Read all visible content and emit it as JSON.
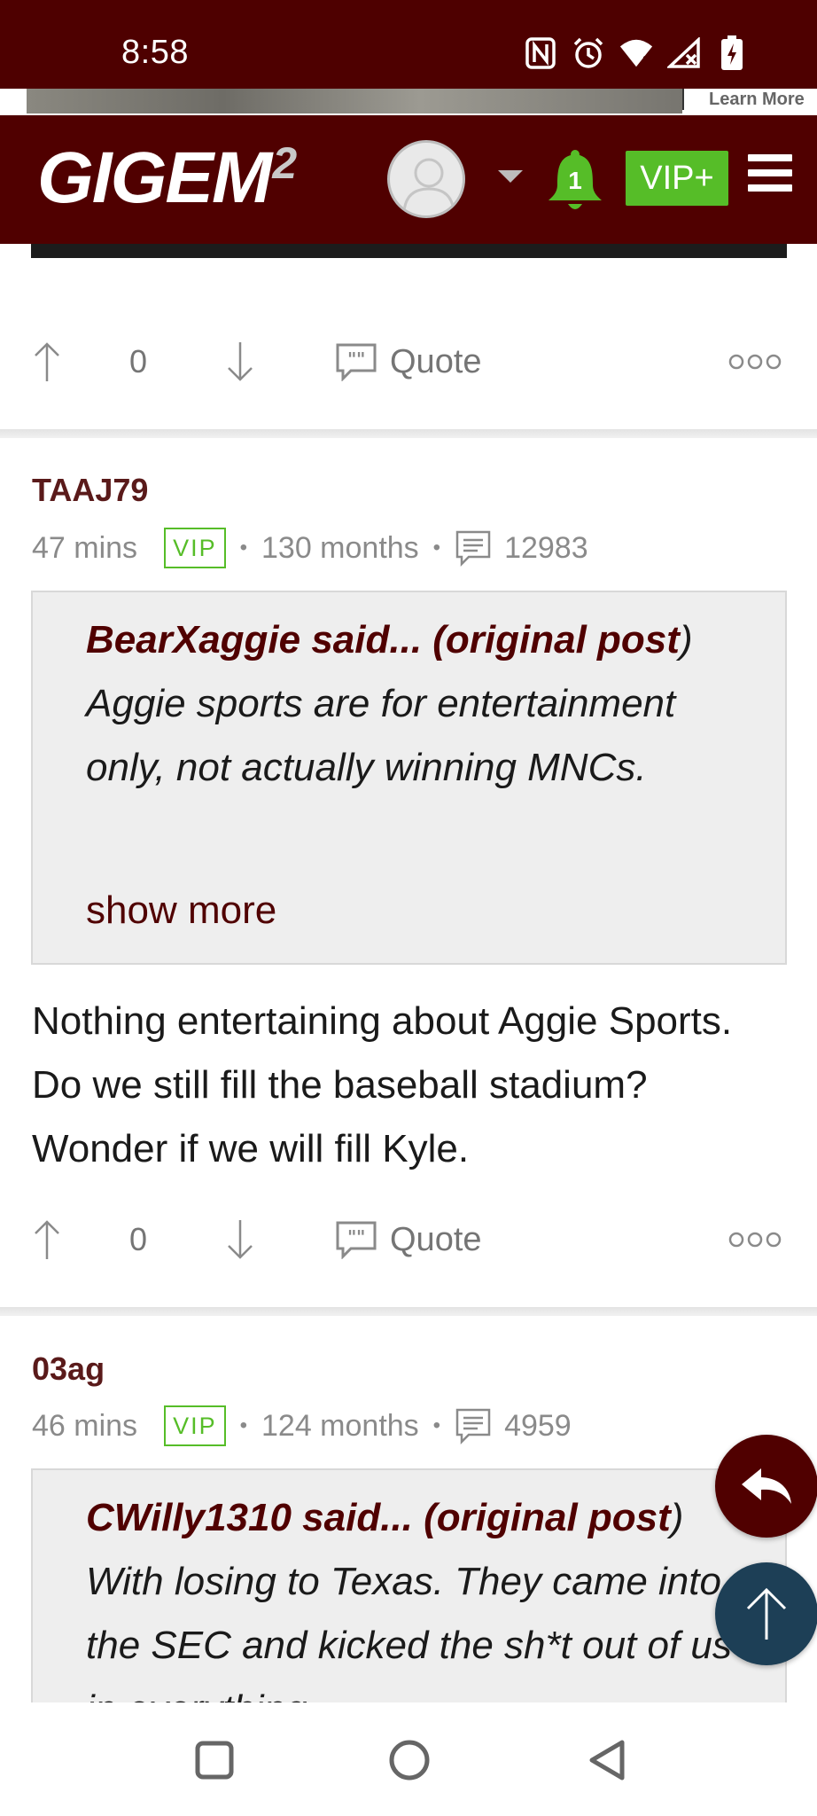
{
  "status_bar": {
    "time": "8:58",
    "icons": [
      "nfc-icon",
      "alarm-icon",
      "wifi-icon",
      "signal-icon",
      "battery-charging-icon"
    ]
  },
  "ad": {
    "cta": "Learn More"
  },
  "header": {
    "logo_main": "GIGEM",
    "logo_sup": "2",
    "notification_count": "1",
    "vip_label": "VIP+"
  },
  "actions": {
    "quote_label": "Quote"
  },
  "posts": [
    {
      "vote_count": "0"
    },
    {
      "author": "TAAJ79",
      "time": "47 mins",
      "badge": "VIP",
      "tenure": "130 months",
      "post_count": "12983",
      "quote_author": "BearXaggie said... (original post",
      "quote_text": ") Aggie sports are for entertainment only, not actually winning MNCs.",
      "show_more": "show more",
      "body": "Nothing entertaining about Aggie Sports. Do we still fill the baseball stadium? Wonder if we will fill Kyle.",
      "vote_count": "0"
    },
    {
      "author": "03ag",
      "time": "46 mins",
      "badge": "VIP",
      "tenure": "124 months",
      "post_count": "4959",
      "quote_author": "CWilly1310 said... (original post",
      "quote_text": ") With losing to Texas. They came into the SEC and kicked the sh*t out of us in everything"
    }
  ],
  "colors": {
    "maroon": "#500000",
    "vip_green": "#56bd28",
    "scroll_top_blue": "#1d3f56"
  }
}
